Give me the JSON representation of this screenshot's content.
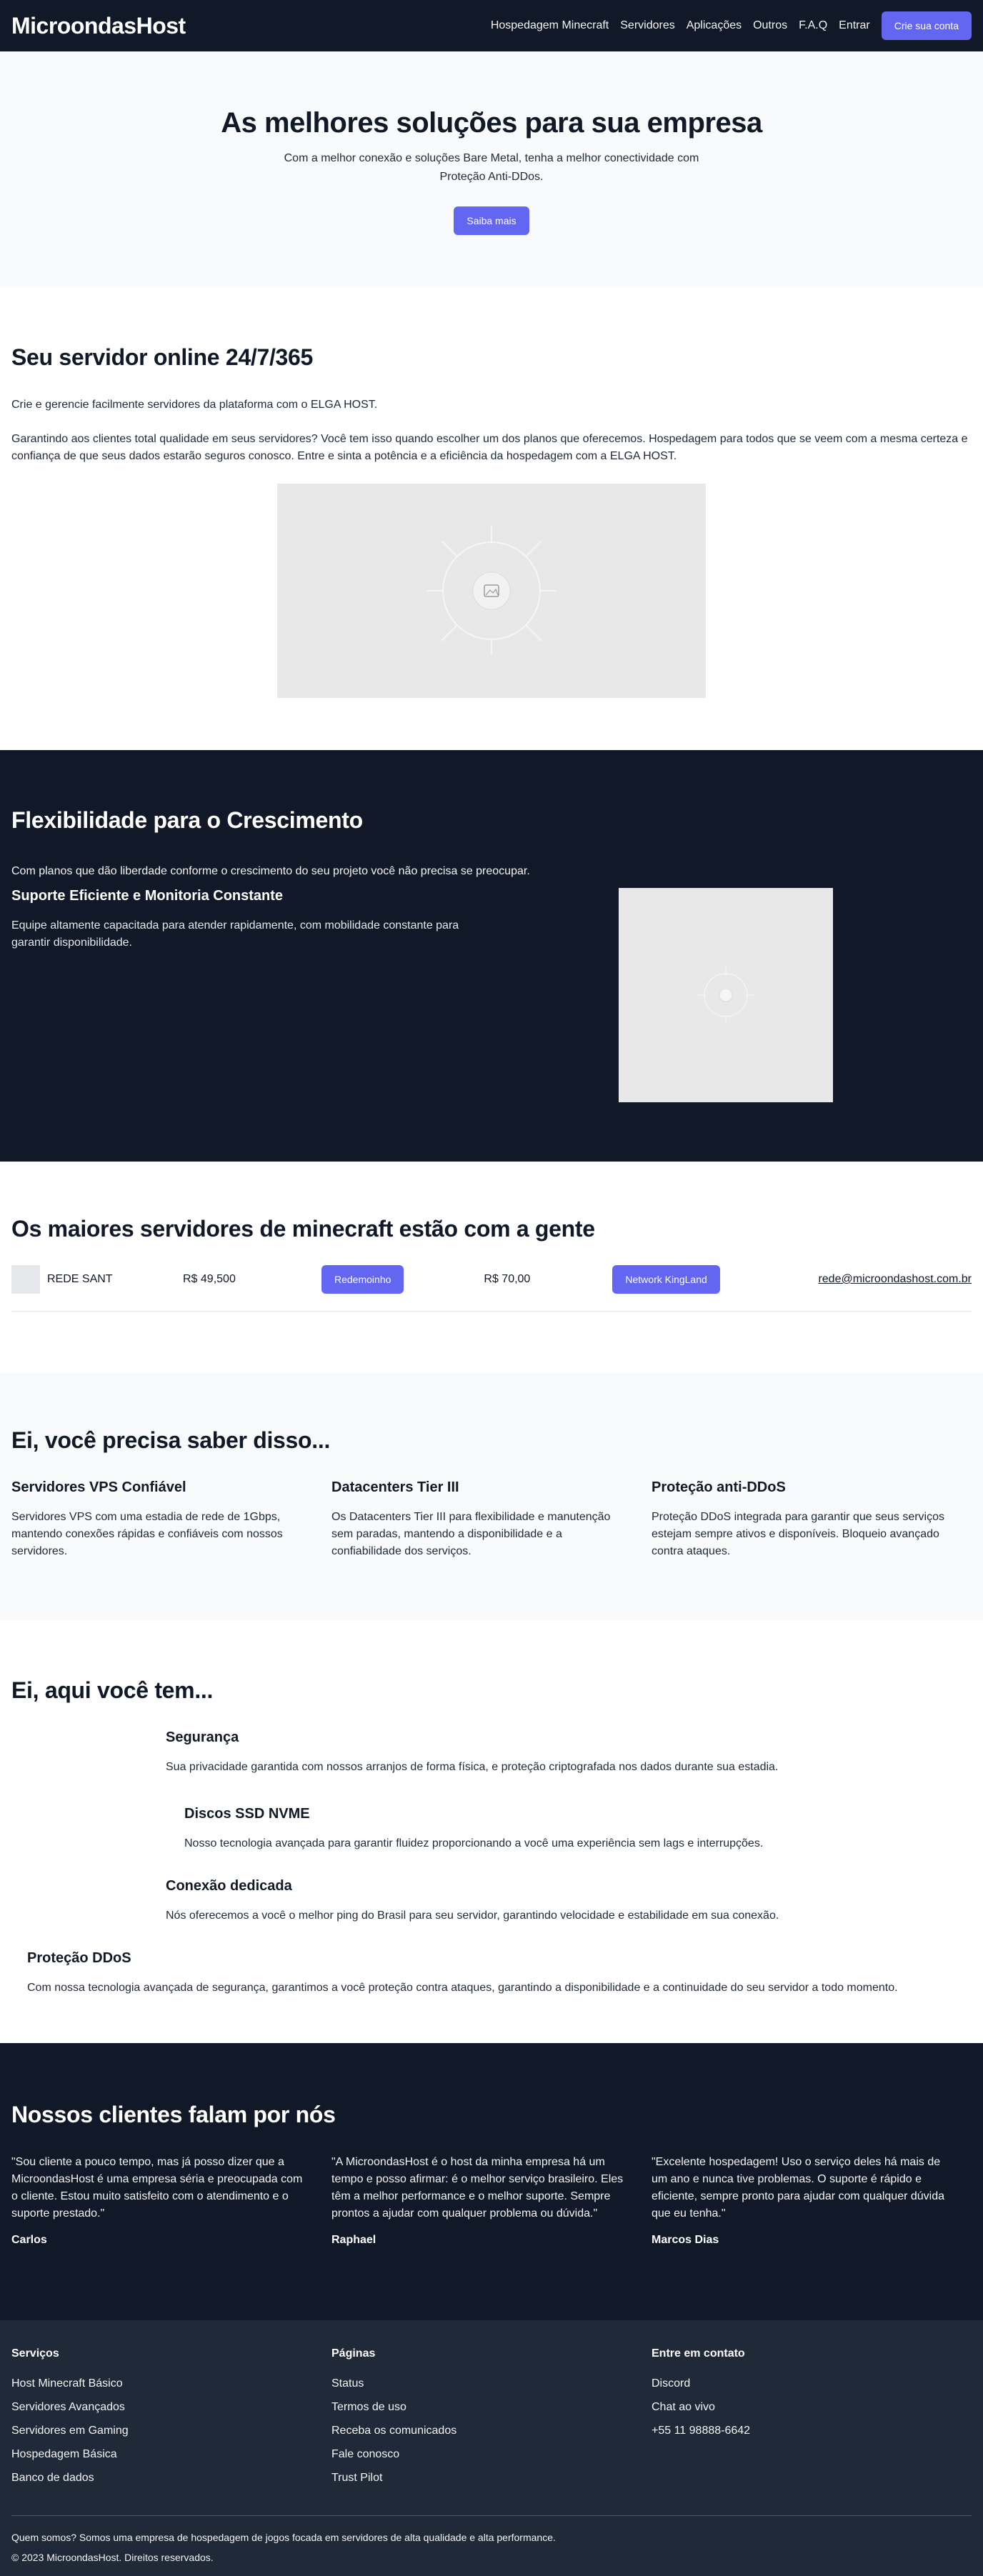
{
  "nav": {
    "brand": "MicroondasHost",
    "links": [
      "Hospedagem Minecraft",
      "Servidores",
      "Aplicações",
      "Outros",
      "F.A.Q",
      "Entrar"
    ],
    "cta": "Crie sua conta"
  },
  "hero": {
    "title": "As melhores soluções para sua empresa",
    "subtitle": "Com a melhor conexão e soluções Bare Metal, tenha a melhor conectividade com Proteção Anti-DDos.",
    "button": "Saiba mais"
  },
  "online": {
    "title": "Seu servidor online 24/7/365",
    "p1": "Crie e gerencie facilmente servidores da plataforma com o ELGA HOST.",
    "p2": "Garantindo aos clientes total qualidade em seus servidores? Você tem isso quando escolher um dos planos que oferecemos. Hospedagem para todos que se veem com a mesma certeza e confiança de que seus dados estarão seguros conosco. Entre e sinta a potência e a eficiência da hospedagem com a ELGA HOST."
  },
  "flex": {
    "title": "Flexibilidade para o Crescimento",
    "intro": "Com planos que dão liberdade conforme o crescimento do seu projeto você não precisa se preocupar.",
    "subtitle": "Suporte Eficiente e Monitoria Constante",
    "text": "Equipe altamente capacitada para atender rapidamente, com mobilidade constante para garantir disponibilidade."
  },
  "mine": {
    "title": "Os maiores servidores de minecraft estão com a gente",
    "name": "REDE SANT",
    "price1": "R$ 49,500",
    "btn1": "Redemoinho",
    "price2": "R$ 70,00",
    "btn2": "Network KingLand",
    "email": "rede@microondashost.com.br"
  },
  "feat": {
    "title": "Ei, você precisa saber disso...",
    "items": [
      {
        "title": "Servidores VPS Confiável",
        "text": "Servidores VPS com uma estadia de rede de 1Gbps, mantendo conexões rápidas e confiáveis com nossos servidores."
      },
      {
        "title": "Datacenters Tier III",
        "text": "Os Datacenters Tier III para flexibilidade e manutenção sem paradas, mantendo a disponibilidade e a confiabilidade dos serviços."
      },
      {
        "title": "Proteção anti-DDoS",
        "text": "Proteção DDoS integrada para garantir que seus serviços estejam sempre ativos e disponíveis. Bloqueio avançado contra ataques."
      }
    ]
  },
  "aqui": {
    "title": "Ei, aqui você tem...",
    "items": [
      {
        "title": "Segurança",
        "text": "Sua privacidade garantida com nossos arranjos de forma física, e proteção criptografada nos dados durante sua estadia."
      },
      {
        "title": "Discos SSD NVME",
        "text": "Nosso tecnologia avançada para garantir fluidez proporcionando a você uma experiência sem lags e interrupções."
      },
      {
        "title": "Conexão dedicada",
        "text": "Nós oferecemos a você o melhor ping do Brasil para seu servidor, garantindo velocidade e estabilidade em sua conexão."
      },
      {
        "title": "Proteção DDoS",
        "text": "Com nossa tecnologia avançada de segurança, garantimos a você proteção contra ataques, garantindo a disponibilidade e a continuidade do seu servidor a todo momento."
      }
    ]
  },
  "test": {
    "title": "Nossos clientes falam por nós",
    "items": [
      {
        "quote": "\"Sou cliente a pouco tempo, mas já posso dizer que a MicroondasHost é uma empresa séria e preocupada com o cliente. Estou muito satisfeito com o atendimento e o suporte prestado.\"",
        "author": "Carlos"
      },
      {
        "quote": "\"A MicroondasHost é o host da minha empresa há um tempo e posso afirmar: é o melhor serviço brasileiro. Eles têm a melhor performance e o melhor suporte. Sempre prontos a ajudar com qualquer problema ou dúvida.\"",
        "author": "Raphael"
      },
      {
        "quote": "\"Excelente hospedagem! Uso o serviço deles há mais de um ano e nunca tive problemas. O suporte é rápido e eficiente, sempre pronto para ajudar com qualquer dúvida que eu tenha.\"",
        "author": "Marcos Dias"
      }
    ]
  },
  "footer": {
    "cols": [
      {
        "title": "Serviços",
        "links": [
          "Host Minecraft Básico",
          "Servidores Avançados",
          "Servidores em Gaming",
          "Hospedagem Básica",
          "Banco de dados"
        ]
      },
      {
        "title": "Páginas",
        "links": [
          "Status",
          "Termos de uso",
          "Receba os comunicados",
          "Fale conosco",
          "Trust Pilot"
        ]
      },
      {
        "title": "Entre em contato",
        "links": [
          "Discord",
          "Chat ao vivo",
          "+55 11 98888-6642"
        ]
      }
    ],
    "about": "Quem somos? Somos uma empresa de hospedagem de jogos focada em servidores de alta qualidade e alta performance.",
    "copy": "© 2023 MicroondasHost. Direitos reservados."
  },
  "colors": {
    "dark": "#111827",
    "accent": "#6366f1",
    "footer": "#1f2937",
    "light": "#f9fafb"
  },
  "icons": {
    "placeholder": "image-placeholder-icon"
  }
}
